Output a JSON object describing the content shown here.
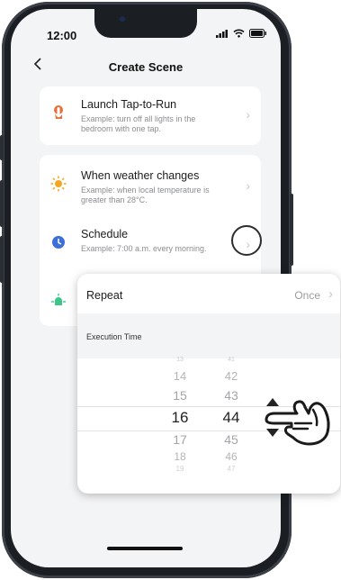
{
  "status": {
    "time": "12:00"
  },
  "header": {
    "title": "Create Scene",
    "back_icon": "chevron-left-icon"
  },
  "cards": [
    {
      "title": "Launch Tap-to-Run",
      "desc": "Example: turn off all lights in the bedroom with one tap.",
      "icon": "tap-hand-icon"
    },
    {
      "title": "When weather changes",
      "desc": "Example: when local temperature is greater than 28°C.",
      "icon": "sun-icon"
    },
    {
      "title": "Schedule",
      "desc": "Example: 7:00 a.m. every morning.",
      "icon": "clock-icon"
    }
  ],
  "popup": {
    "repeat_label": "Repeat",
    "repeat_value": "Once",
    "execution_label": "Execution Time",
    "hours": [
      "13",
      "14",
      "15",
      "16",
      "17",
      "18",
      "19"
    ],
    "minutes": [
      "41",
      "42",
      "43",
      "44",
      "45",
      "46",
      "47"
    ],
    "selected_hour": "16",
    "selected_minute": "44"
  },
  "colors": {
    "accent_blue": "#3d6fd6",
    "sun": "#f5a623",
    "tap": "#e8703a",
    "green": "#3cc68a"
  }
}
